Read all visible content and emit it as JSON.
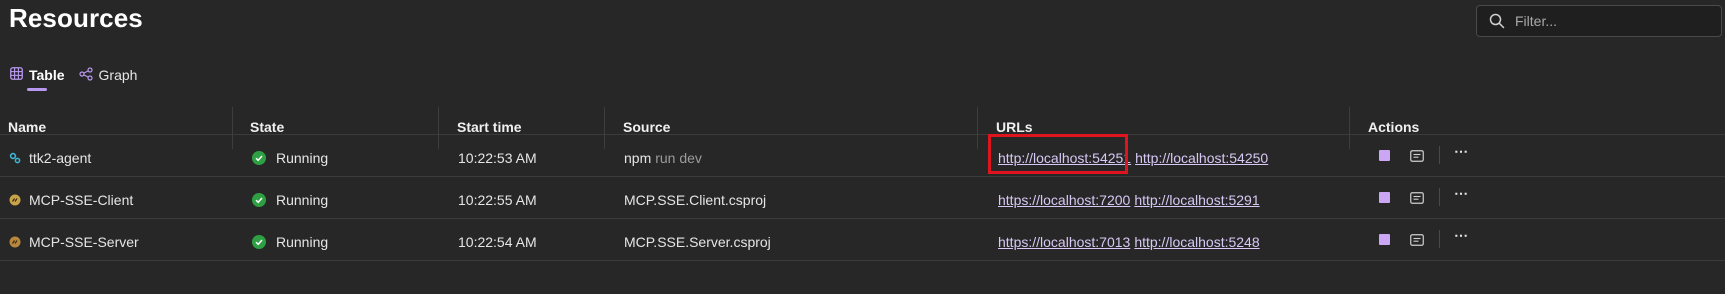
{
  "header": {
    "title": "Resources"
  },
  "filter": {
    "placeholder": "Filter..."
  },
  "tabs": [
    {
      "label": "Table",
      "active": true,
      "icon": "table-icon"
    },
    {
      "label": "Graph",
      "active": false,
      "icon": "graph-icon"
    }
  ],
  "columns": [
    "Name",
    "State",
    "Start time",
    "Source",
    "URLs",
    "Actions"
  ],
  "rows": [
    {
      "name": "ttk2-agent",
      "icon": "gear-cluster-icon",
      "state": "Running",
      "start": "10:22:53 AM",
      "source": "npm",
      "source_args": "run dev",
      "url1": "http://localhost:54251",
      "url2": "http://localhost:54250"
    },
    {
      "name": "MCP-SSE-Client",
      "icon": "project-icon",
      "state": "Running",
      "start": "10:22:55 AM",
      "source": "MCP.SSE.Client.csproj",
      "source_args": "",
      "url1": "https://localhost:7200",
      "url2": "http://localhost:5291"
    },
    {
      "name": "MCP-SSE-Server",
      "icon": "project-icon",
      "state": "Running",
      "start": "10:22:54 AM",
      "source": "MCP.SSE.Server.csproj",
      "source_args": "",
      "url1": "https://localhost:7013",
      "url2": "http://localhost:5248"
    }
  ],
  "colors": {
    "accent": "#b999f0",
    "running": "#2ea043",
    "highlight": "#e0141e",
    "link": "#d8c8f5"
  }
}
